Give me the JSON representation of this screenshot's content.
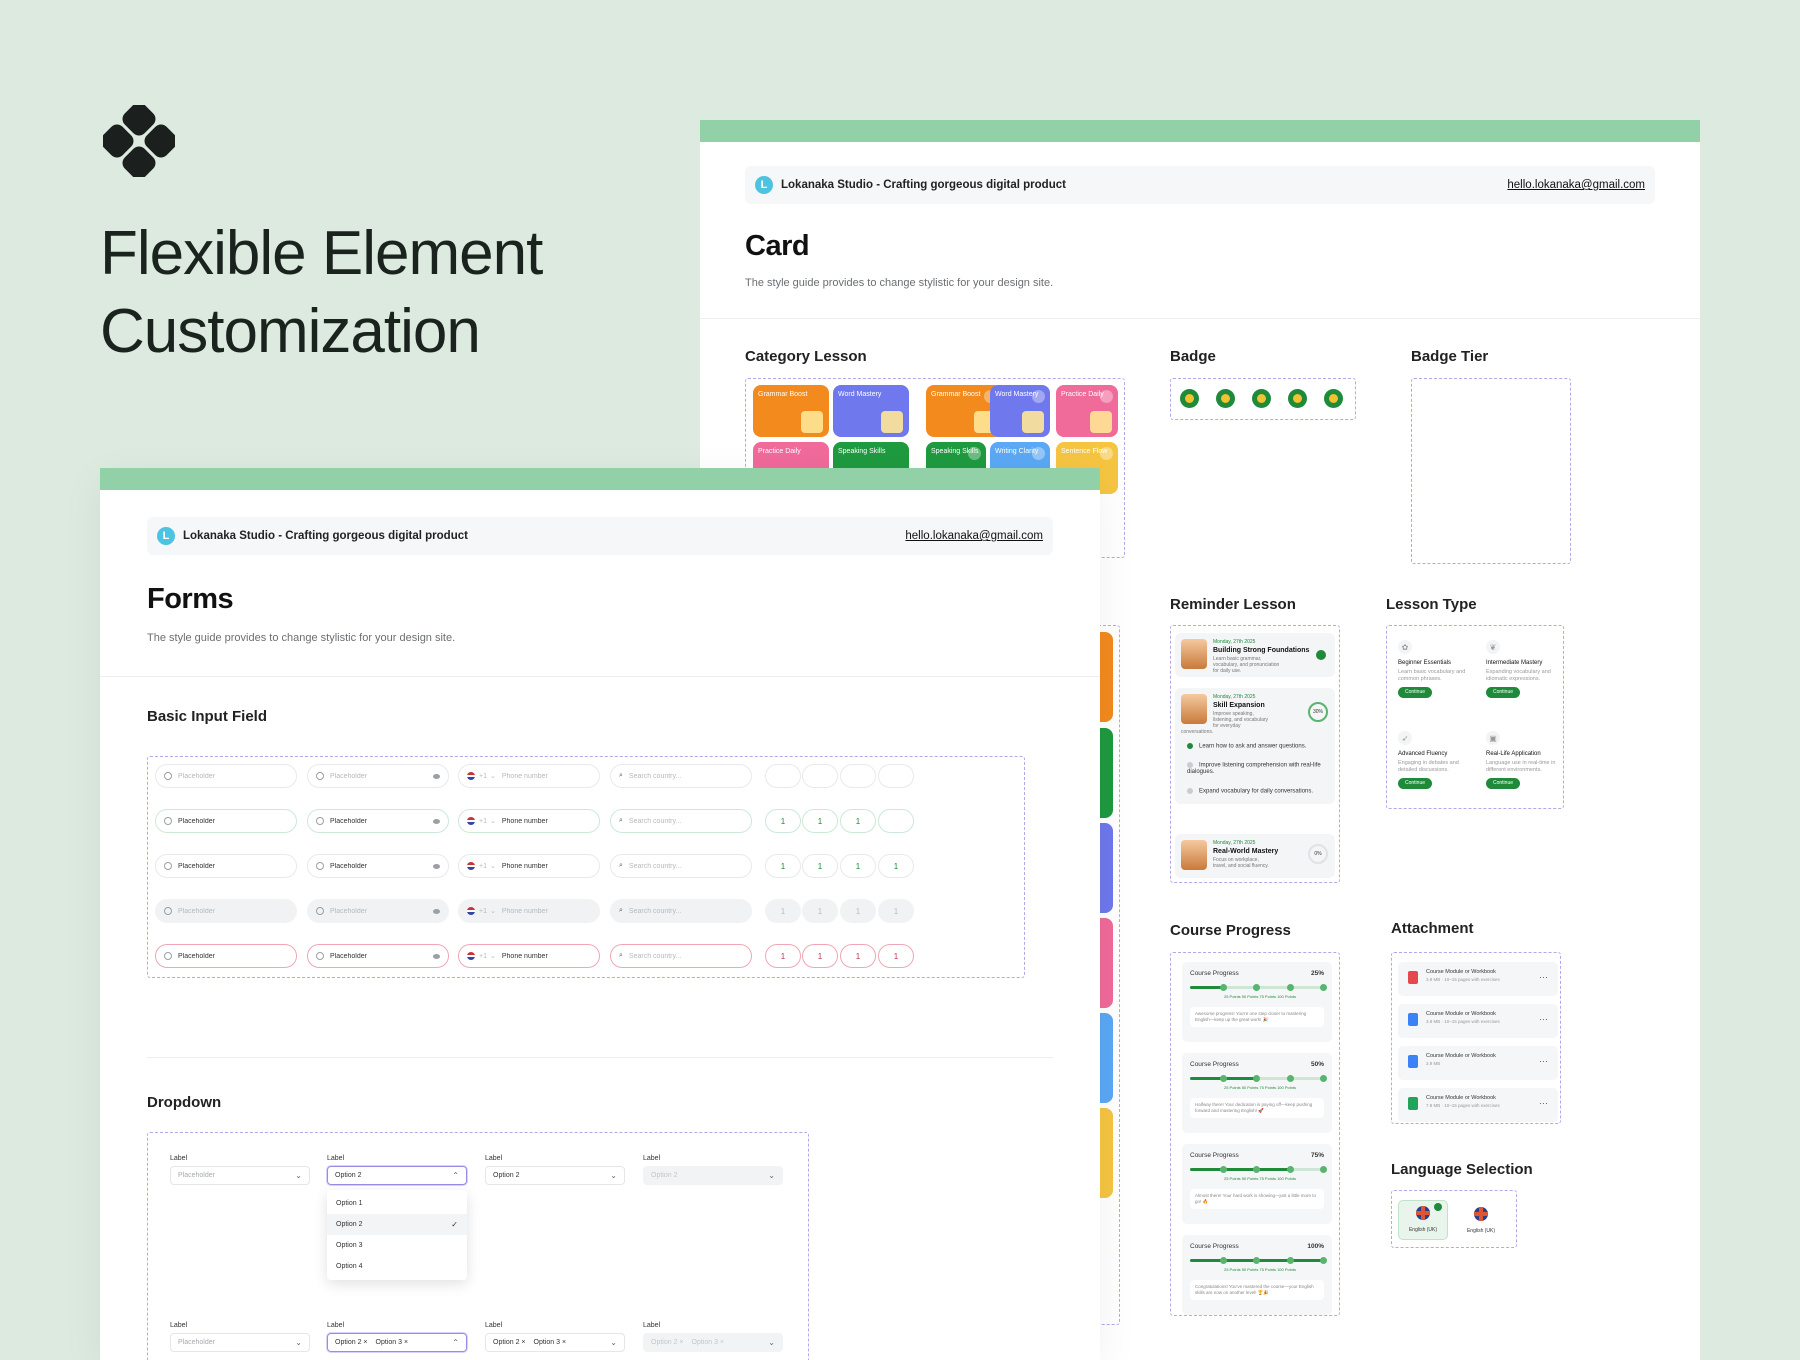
{
  "hero": {
    "line1": "Flexible Element",
    "line2": "Customization"
  },
  "brand": {
    "name": "Lokanaka Studio - Crafting gorgeous digital product",
    "email": "hello.lokanaka@gmail.com"
  },
  "card_page": {
    "title": "Card",
    "subtitle": "The style guide provides to change stylistic for your design site.",
    "sections": {
      "category": "Category Lesson",
      "badge": "Badge",
      "badge_tier": "Badge Tier",
      "reminder": "Reminder Lesson",
      "lesson_type": "Lesson Type",
      "course_progress": "Course Progress",
      "attachment": "Attachment",
      "language": "Language Selection"
    },
    "categories": [
      {
        "label": "Grammar Boost",
        "color": "#f28a1e"
      },
      {
        "label": "Word Mastery",
        "color": "#6f78ec"
      },
      {
        "label": "Grammar Boost",
        "color": "#f28a1e"
      },
      {
        "label": "Word Mastery",
        "color": "#6f78ec"
      },
      {
        "label": "Practice Daily",
        "color": "#f06a9a"
      },
      {
        "label": "Practice Daily",
        "color": "#f06a9a"
      },
      {
        "label": "Speaking Skills",
        "color": "#1e9a3f"
      },
      {
        "label": "Speaking Skills",
        "color": "#1e9a3f"
      },
      {
        "label": "Writing Clarity",
        "color": "#5ba8f5"
      },
      {
        "label": "Sentence Flow",
        "color": "#f5c542"
      }
    ],
    "reminders": [
      {
        "date": "Monday, 27th 2025",
        "title": "Building Strong Foundations",
        "desc": "Learn basic grammar, vocabulary, and pronunciation for daily use."
      },
      {
        "date": "Monday, 27th 2025",
        "title": "Skill Expansion",
        "desc": "Improve speaking, listening, and vocabulary for everyday conversations.",
        "percent": "30%",
        "items": [
          "Learn how to ask and answer questions.",
          "Improve listening comprehension with real-life dialogues.",
          "Expand vocabulary for daily conversations."
        ]
      },
      {
        "date": "Monday, 27th 2025",
        "title": "Real-World Mastery",
        "desc": "Focus on workplace, travel, and social fluency.",
        "percent": "0%"
      }
    ],
    "lesson_types": [
      {
        "name": "Beginner Essentials",
        "desc": "Learn basic vocabulary and common phrases.",
        "button": "Continue"
      },
      {
        "name": "Intermediate Mastery",
        "desc": "Expanding vocabulary and idiomatic expressions.",
        "button": "Continue"
      },
      {
        "name": "Advanced Fluency",
        "desc": "Engaging in debates and detailed discussions.",
        "button": "Continue"
      },
      {
        "name": "Real-Life Application",
        "desc": "Language use in real-time in different environments.",
        "button": "Continue"
      }
    ],
    "course_progress": [
      {
        "label": "Course Progress",
        "percent": "25%",
        "value": 25,
        "msg": "Awesome progress! You're one step closer to mastering English—keep up the great work! 🎉"
      },
      {
        "label": "Course Progress",
        "percent": "50%",
        "value": 50,
        "msg": "Halfway there! Your dedication is paying off—keep pushing forward and mastering English! 🚀"
      },
      {
        "label": "Course Progress",
        "percent": "75%",
        "value": 75,
        "msg": "Almost there! Your hard work is showing—just a little more to go! 🔥"
      },
      {
        "label": "Course Progress",
        "percent": "100%",
        "value": 100,
        "msg": "Congratulations! You've mastered the course—your English skills are now on another level! 🏆🎉"
      }
    ],
    "progress_ticks": [
      "25 Points",
      "50 Points",
      "75 Points",
      "100 Points"
    ],
    "attachments": [
      {
        "name": "Course Module or Workbook",
        "meta": "3.9 MB  ·  10–15 pages with exercises",
        "color": "#e5484d"
      },
      {
        "name": "Course Module or Workbook",
        "meta": "3.9 MB  ·  10–15 pages with exercises",
        "color": "#3b82f6"
      },
      {
        "name": "Course Module or Workbook",
        "meta": "3.9 MB",
        "color": "#3b82f6"
      },
      {
        "name": "Course Module or Workbook",
        "meta": "7.8 MB  ·  10–15 pages with exercises",
        "color": "#22a35a"
      }
    ],
    "languages": [
      {
        "label": "English (UK)",
        "selected": true
      },
      {
        "label": "English (UK)",
        "selected": false
      }
    ]
  },
  "forms_page": {
    "title": "Forms",
    "subtitle": "The style guide provides to change stylistic for your design site.",
    "basic_input": "Basic Input Field",
    "dropdown": "Dropdown",
    "input": {
      "placeholder": "Placeholder",
      "phone_code": "+1",
      "phone": "Phone number",
      "search": "Search country...",
      "otp": "1"
    },
    "dropdown_labels": {
      "label": "Label",
      "placeholder": "Placeholder",
      "option2": "Option 2",
      "option3": "Option 3"
    },
    "menu_options": [
      "Option 1",
      "Option 2",
      "Option 3",
      "Option 4"
    ]
  }
}
